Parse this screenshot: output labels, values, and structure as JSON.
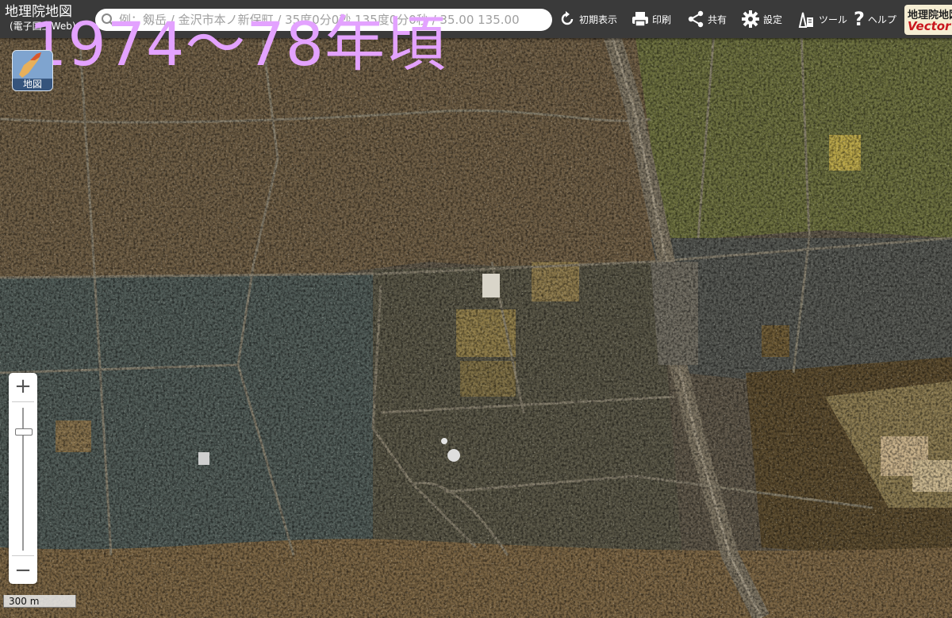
{
  "app": {
    "title": "地理院地図",
    "subtitle": "(電子国土Web)"
  },
  "search": {
    "placeholder": "例：剱岳 / 金沢市本ノ新保町 / 35度0分0秒 135度0分0秒 / 35.00 135.00"
  },
  "toolbar": [
    {
      "label": "初期表示",
      "icon": "reset-icon"
    },
    {
      "label": "印刷",
      "icon": "print-icon"
    },
    {
      "label": "共有",
      "icon": "share-icon"
    },
    {
      "label": "設定",
      "icon": "gear-icon"
    },
    {
      "label": "ツール",
      "icon": "tool-icon"
    },
    {
      "label": "ヘルプ",
      "icon": "help-icon"
    }
  ],
  "logo": {
    "line1": "地理院地図",
    "line2": "Vector"
  },
  "overlay_title": "1974～78年頃",
  "layer_button": {
    "label": "地図"
  },
  "zoom": {
    "in": "+",
    "out": "−"
  },
  "scale": {
    "label": "300 m"
  },
  "colors": {
    "title_text": "#e3a2ff",
    "toolbar_bg": "#3a3a3a"
  }
}
